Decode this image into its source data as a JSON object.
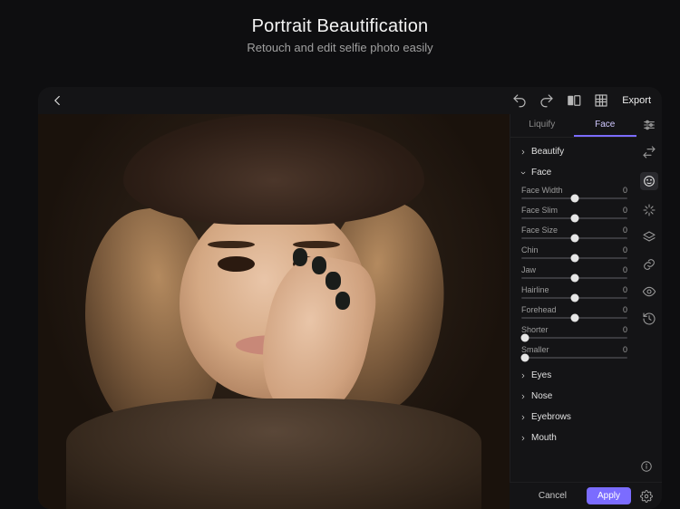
{
  "hero": {
    "title": "Portrait Beautification",
    "subtitle": "Retouch and edit selfie photo easily"
  },
  "topbar": {
    "export_label": "Export"
  },
  "tabs": {
    "liquify": "Liquify",
    "face": "Face"
  },
  "groups": {
    "beautify": "Beautify",
    "face": "Face",
    "eyes": "Eyes",
    "nose": "Nose",
    "eyebrows": "Eyebrows",
    "mouth": "Mouth"
  },
  "sliders": [
    {
      "label": "Face Width",
      "value": 0,
      "pos": 50
    },
    {
      "label": "Face Slim",
      "value": 0,
      "pos": 50
    },
    {
      "label": "Face Size",
      "value": 0,
      "pos": 50
    },
    {
      "label": "Chin",
      "value": 0,
      "pos": 50
    },
    {
      "label": "Jaw",
      "value": 0,
      "pos": 50
    },
    {
      "label": "Hairline",
      "value": 0,
      "pos": 50
    },
    {
      "label": "Forehead",
      "value": 0,
      "pos": 50
    },
    {
      "label": "Shorter",
      "value": 0,
      "pos": 3
    },
    {
      "label": "Smaller",
      "value": 0,
      "pos": 3
    }
  ],
  "footer": {
    "cancel": "Cancel",
    "apply": "Apply"
  }
}
